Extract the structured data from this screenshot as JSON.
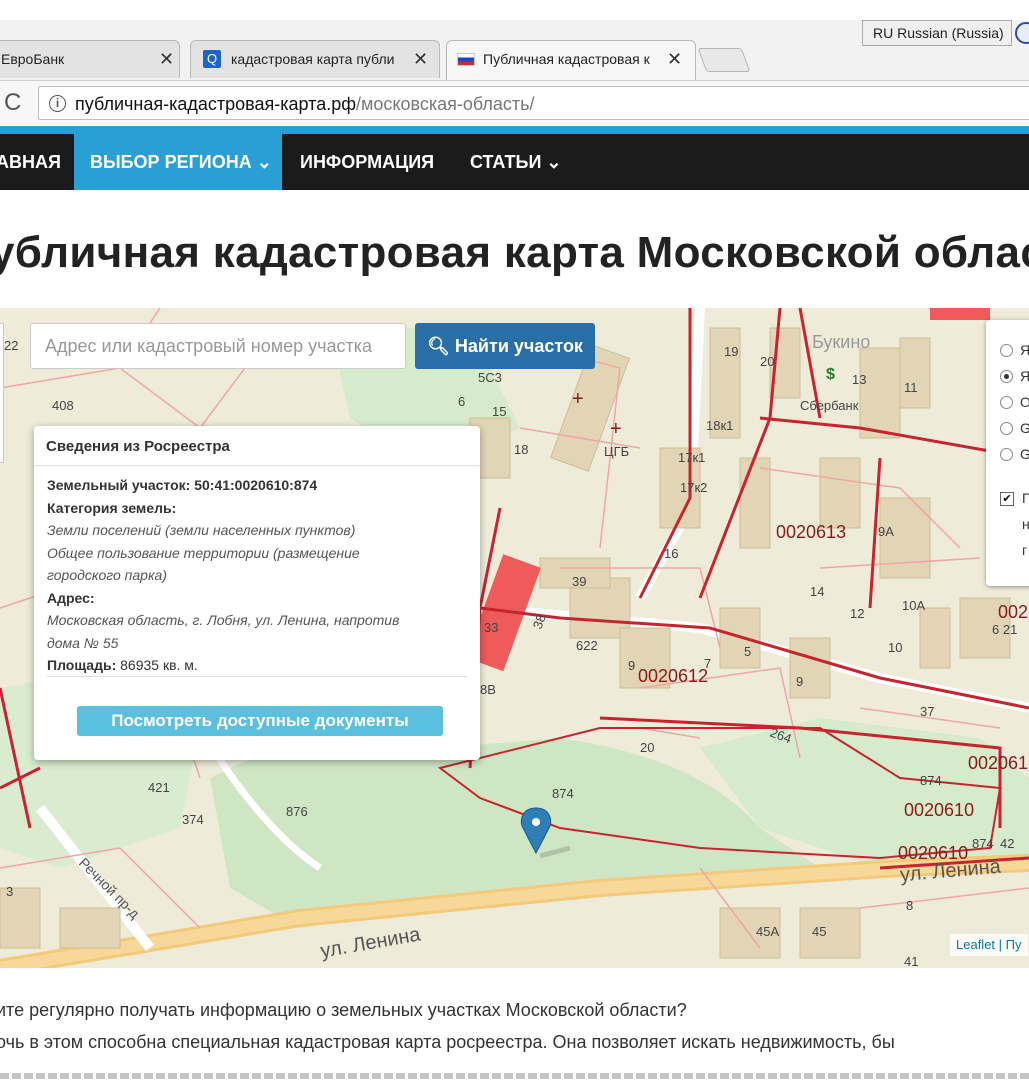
{
  "browser": {
    "language": "RU Russian (Russia)",
    "tabs": [
      {
        "label": "ЕвроБанк",
        "favicon": "none"
      },
      {
        "label": "кадастровая карта публи",
        "favicon": "search-icon"
      },
      {
        "label": "Публичная кадастровая к",
        "favicon": "ru-flag-icon",
        "active": true
      }
    ],
    "url_host": "публичная-кадастровая-карта.рф",
    "url_path": "/московская-область/"
  },
  "nav": {
    "items": [
      {
        "label": "АВНАЯ"
      },
      {
        "label": "ВЫБОР РЕГИОНА ⌄",
        "active": true
      },
      {
        "label": "ИНФОРМАЦИЯ"
      },
      {
        "label": "СТАТЬИ ⌄"
      }
    ]
  },
  "page_title": "убличная кадастровая карта Московской облас",
  "map": {
    "search_placeholder": "Адрес или кадастровый номер участка",
    "find_button": "Найти участок",
    "popup": {
      "title": "Сведения из Росреестра",
      "parcel_label": "Земельный участок:",
      "parcel_number": "50:41:0020610:874",
      "category_label": "Категория земель:",
      "category_line1": "Земли поселений (земли населенных пунктов)",
      "category_line2": "Общее пользование территории (размещение",
      "category_line3": "городского парка)",
      "address_label": "Адрес:",
      "address_line1": "Московская область, г. Лобня, ул. Ленина, напротив",
      "address_line2": "дома № 55",
      "area_label": "Площадь:",
      "area_value": "86935 кв. м.",
      "docs_button": "Посмотреть доступные документы"
    },
    "layers": [
      "Я",
      "Я",
      "О",
      "G",
      "G"
    ],
    "layer_selected_index": 1,
    "overlay_letters": [
      "П",
      "н",
      "г"
    ],
    "attribution_leaflet": "Leaflet",
    "attribution_other": "| Пу",
    "labels": {
      "quarter_613": "0020613",
      "quarter_612": "0020612",
      "quarter_610": "0020610",
      "quarter_610b": "0020610",
      "quarter_61x": "002061",
      "quarter_02": "002",
      "parcel_874": "874",
      "parcel_874b": "874",
      "parcel_874c": "874",
      "street_lenina": "ул. Ленина",
      "street_lenina2": "ул. Ленина",
      "street_rechnoy": "Речной пр-д",
      "district": "Букино",
      "sberbank": "Сбербанк",
      "tsgb": "ЦГБ",
      "n408": "408",
      "n5c3": "5С3",
      "n15": "15",
      "n18": "18",
      "n19": "19",
      "n13": "13",
      "n11": "11",
      "n18k1": "18к1",
      "n17k1": "17к1",
      "n17k2": "17к2",
      "n16": "16",
      "n39": "39",
      "n38": "38",
      "n33": "33",
      "n622": "622",
      "n9": "9",
      "n7": "7",
      "n5": "5",
      "n14": "14",
      "n12": "12",
      "n10a": "10А",
      "n10": "10",
      "n9a": "9А",
      "n9b": "9",
      "n8b": "8В",
      "n20": "20",
      "n264": "264",
      "n37": "37",
      "n421": "421",
      "n374": "374",
      "n876": "876",
      "n45a": "45А",
      "n45": "45",
      "n41": "41",
      "n3": "3",
      "n621": "6 21",
      "n42": "42",
      "n8": "8",
      "n22": "22",
      "n6": "6",
      "n20top": "20"
    }
  },
  "paragraphs": [
    "ите регулярно получать информацию о земельных участках Московской области?",
    "очь в этом способна специальная кадастровая карта росреестра. Она позволяет искать недвижимость, бы"
  ]
}
